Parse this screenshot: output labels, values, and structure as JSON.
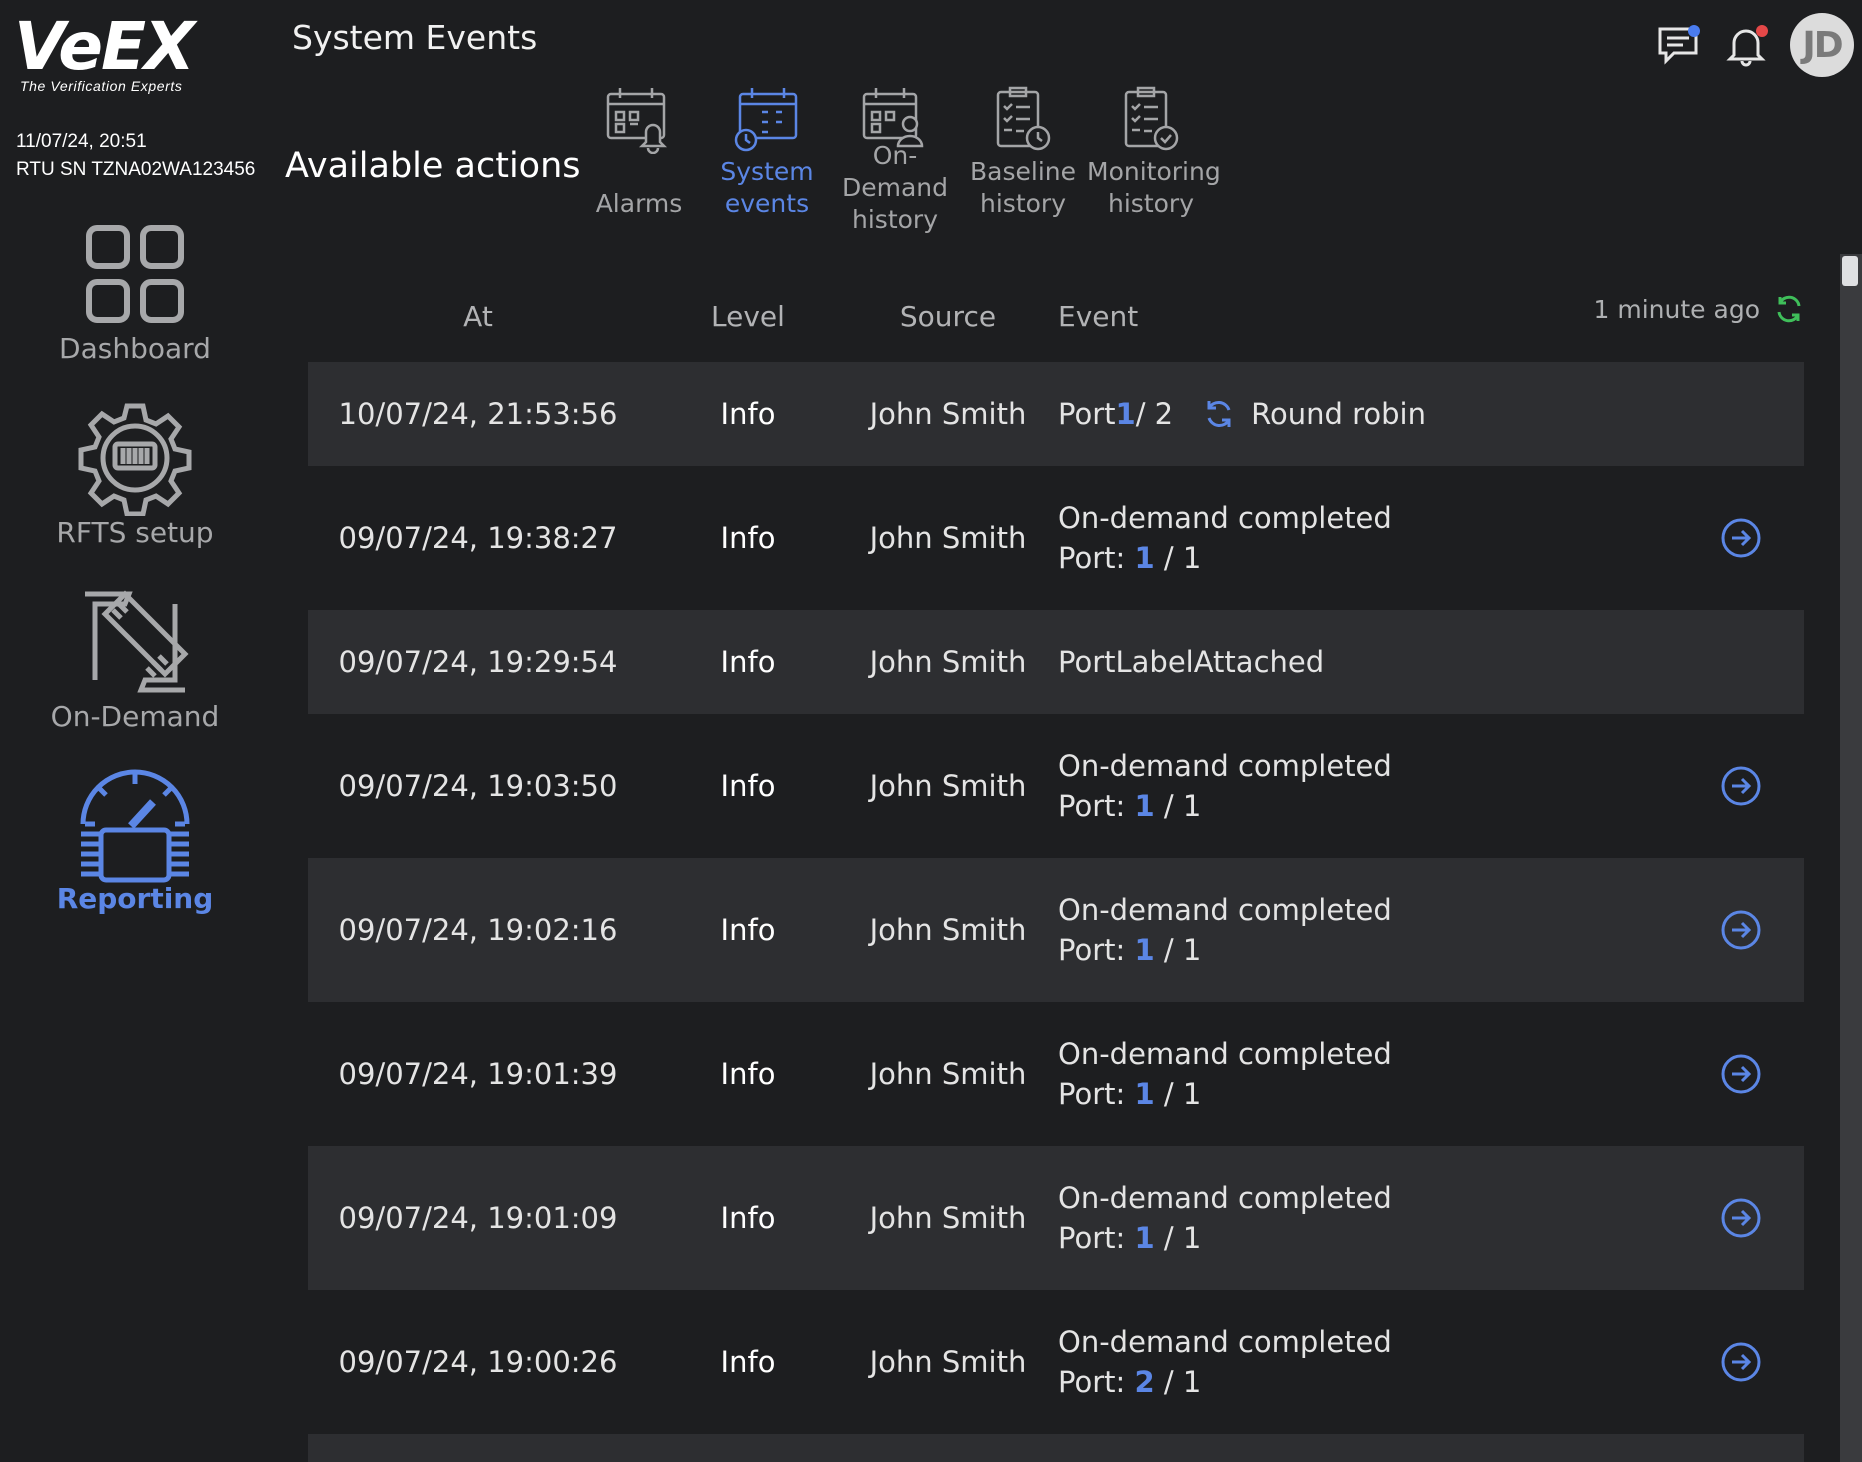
{
  "brand": {
    "logo_text": "VeEX",
    "tagline": "The Verification Experts"
  },
  "device": {
    "datetime": "11/07/24, 20:51",
    "serial": "RTU SN TZNA02WA123456"
  },
  "sidebar": {
    "items": [
      {
        "label": "Dashboard",
        "icon": "dashboard-icon",
        "active": false
      },
      {
        "label": "RFTS setup",
        "icon": "rfts-gear-icon",
        "active": false
      },
      {
        "label": "On-Demand",
        "icon": "on-demand-icon",
        "active": false
      },
      {
        "label": "Reporting",
        "icon": "reporting-gauge-icon",
        "active": true
      }
    ]
  },
  "header": {
    "title": "System Events",
    "avatar_initials": "JD",
    "messages_dot_color": "#4a7cf0",
    "notifications_dot_color": "#e54848"
  },
  "actions": {
    "title": "Available actions",
    "items": [
      {
        "line1": "",
        "line2": "Alarms",
        "line3": "",
        "active": false,
        "icon": "alarm-calendar-icon"
      },
      {
        "line1": "System",
        "line2": "events",
        "line3": "",
        "active": true,
        "icon": "system-events-calendar-icon"
      },
      {
        "line1": "On-",
        "line2": "Demand",
        "line3": "history",
        "active": false,
        "icon": "on-demand-history-icon"
      },
      {
        "line1": "Baseline",
        "line2": "history",
        "line3": "",
        "active": false,
        "icon": "baseline-history-icon"
      },
      {
        "line1": "Monitoring",
        "line2": "history",
        "line3": "",
        "active": false,
        "icon": "monitoring-history-icon"
      }
    ]
  },
  "table": {
    "columns": {
      "at": "At",
      "level": "Level",
      "source": "Source",
      "event": "Event"
    },
    "updated": "1 minute ago",
    "rows": [
      {
        "at": "10/07/24, 21:53:56",
        "level": "Info",
        "source": "John Smith",
        "event_line1": "",
        "port_label": "Port ",
        "port_num": "1",
        "port_total": " / 2",
        "extra": "Round robin"
      },
      {
        "at": "09/07/24, 19:38:27",
        "level": "Info",
        "source": "John Smith",
        "event_line1": "On-demand completed",
        "port_label": "Port: ",
        "port_num": "1",
        "port_total": " / 1",
        "extra": ""
      },
      {
        "at": "09/07/24, 19:29:54",
        "level": "Info",
        "source": "John Smith",
        "event_line1": "PortLabelAttached",
        "port_label": "",
        "port_num": "",
        "port_total": "",
        "extra": ""
      },
      {
        "at": "09/07/24, 19:03:50",
        "level": "Info",
        "source": "John Smith",
        "event_line1": "On-demand completed",
        "port_label": "Port: ",
        "port_num": "1",
        "port_total": " / 1",
        "extra": ""
      },
      {
        "at": "09/07/24, 19:02:16",
        "level": "Info",
        "source": "John Smith",
        "event_line1": "On-demand completed",
        "port_label": "Port: ",
        "port_num": "1",
        "port_total": " / 1",
        "extra": ""
      },
      {
        "at": "09/07/24, 19:01:39",
        "level": "Info",
        "source": "John Smith",
        "event_line1": "On-demand completed",
        "port_label": "Port: ",
        "port_num": "1",
        "port_total": " / 1",
        "extra": ""
      },
      {
        "at": "09/07/24, 19:01:09",
        "level": "Info",
        "source": "John Smith",
        "event_line1": "On-demand completed",
        "port_label": "Port: ",
        "port_num": "1",
        "port_total": " / 1",
        "extra": ""
      },
      {
        "at": "09/07/24, 19:00:26",
        "level": "Info",
        "source": "John Smith",
        "event_line1": "On-demand completed",
        "port_label": "Port: ",
        "port_num": "2",
        "port_total": " / 1",
        "extra": ""
      }
    ]
  },
  "colors": {
    "accent": "#5b86e5",
    "refresh": "#3fbf5a",
    "background": "#1d1e20",
    "row_shade": "#2d2e31"
  }
}
